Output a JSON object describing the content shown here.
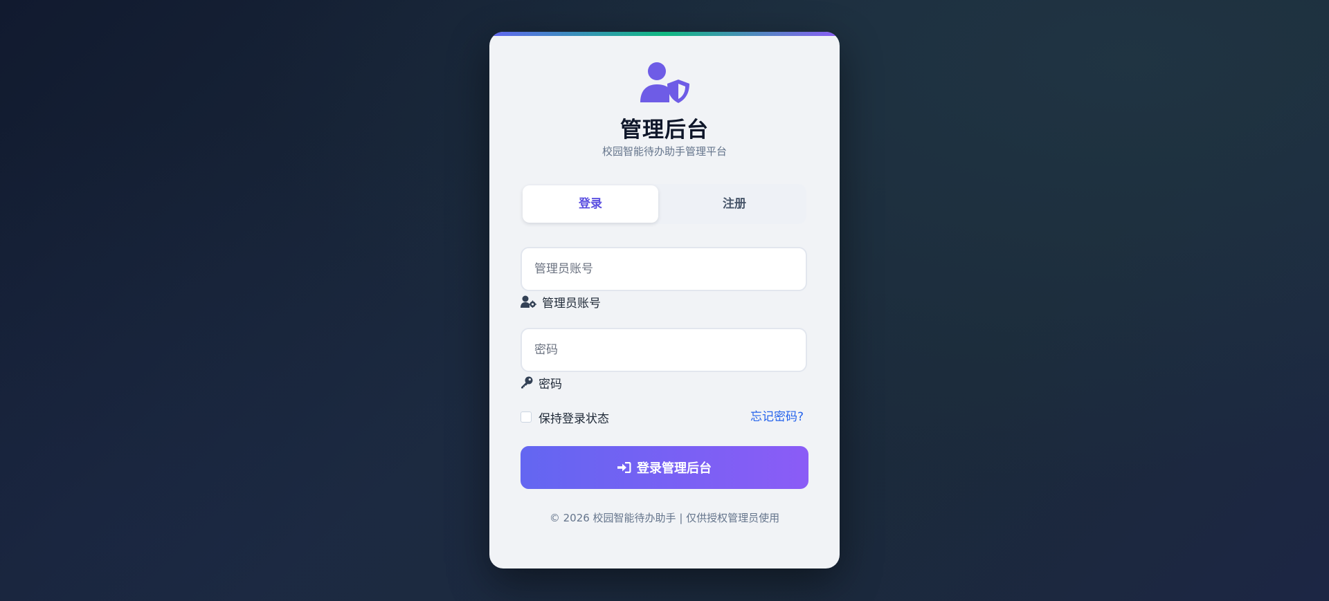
{
  "header": {
    "logo_icon": "user-shield-icon",
    "title": "管理后台",
    "subtitle": "校园智能待办助手管理平台"
  },
  "tabs": [
    {
      "label": "登录",
      "active": true
    },
    {
      "label": "注册",
      "active": false
    }
  ],
  "form": {
    "account": {
      "placeholder": "管理员账号",
      "value": "",
      "label": "管理员账号",
      "icon": "user-gear-icon"
    },
    "password": {
      "placeholder": "密码",
      "value": "",
      "label": "密码",
      "icon": "key-icon"
    },
    "remember_label": "保持登录状态",
    "remember_checked": false,
    "forgot_label": "忘记密码?",
    "submit_label": "登录管理后台",
    "submit_icon": "sign-in-icon"
  },
  "footer": {
    "text": "© 2026 校园智能待办助手 | 仅供授权管理员使用"
  },
  "colors": {
    "accent": "#6366f1",
    "accent_end": "#8b5cf6",
    "link": "#2563eb",
    "card_bg": "#f1f3f6"
  }
}
